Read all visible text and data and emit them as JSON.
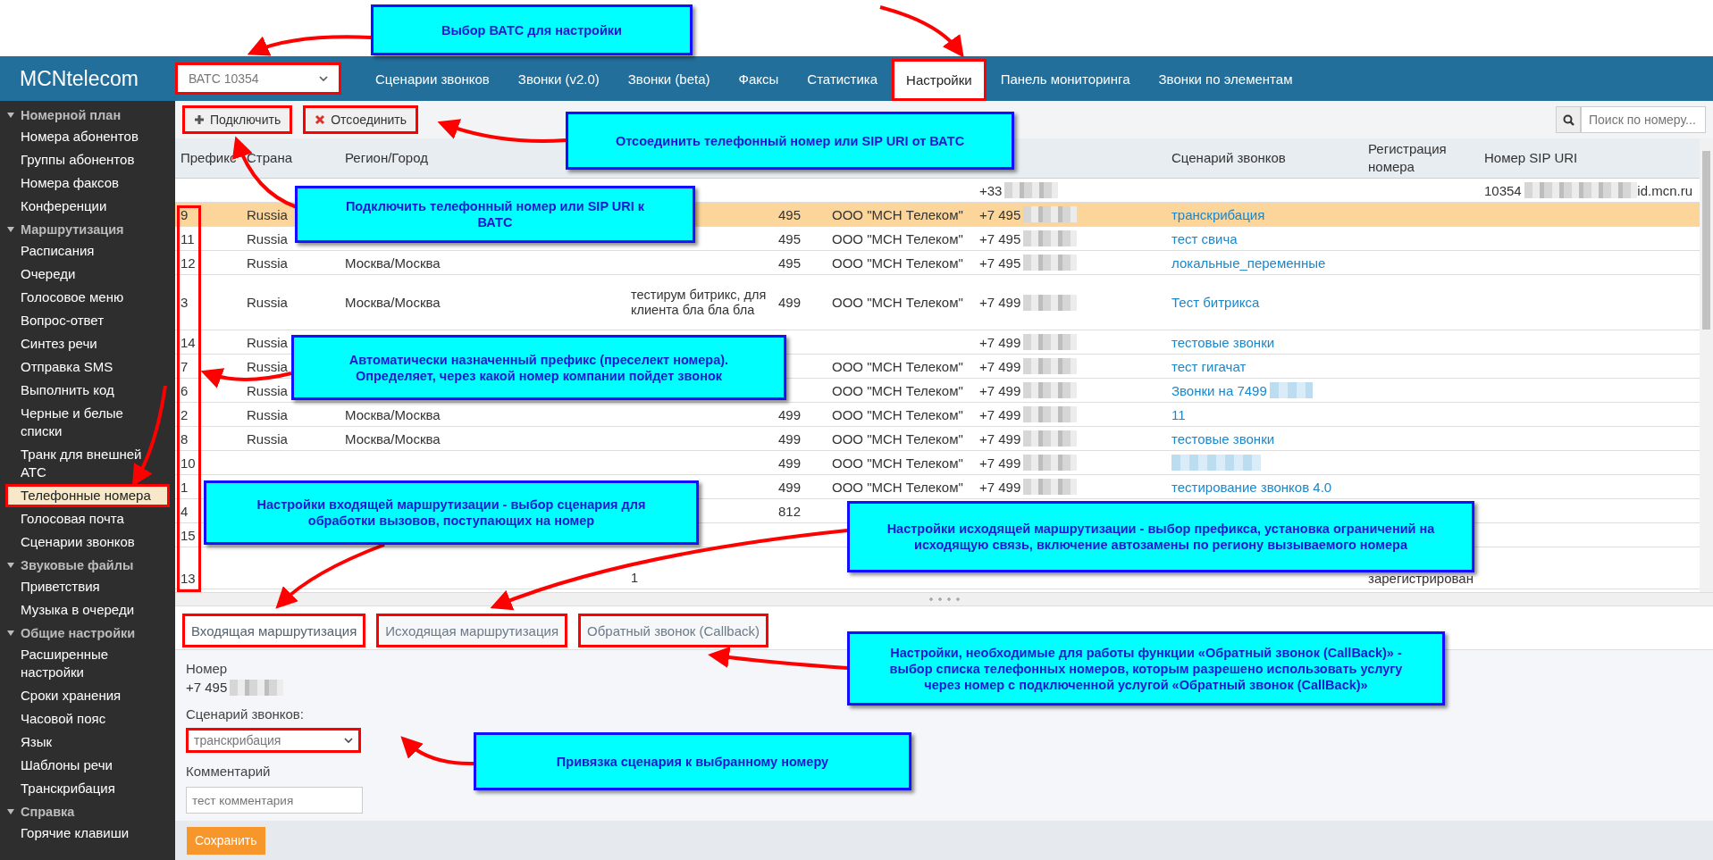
{
  "header": {
    "logo": "MCNtelecom",
    "pbx_select": {
      "value": "ВАТС 10354",
      "highlighted": true
    },
    "tabs": [
      {
        "label": "Сценарии звонков",
        "selected": false
      },
      {
        "label": "Звонки (v2.0)",
        "selected": false
      },
      {
        "label": "Звонки (beta)",
        "selected": false
      },
      {
        "label": "Факсы",
        "selected": false
      },
      {
        "label": "Статистика",
        "selected": false
      },
      {
        "label": "Настройки",
        "selected": true
      },
      {
        "label": "Панель мониторинга",
        "selected": false
      },
      {
        "label": "Звонки по элементам",
        "selected": false
      }
    ]
  },
  "sidebar": {
    "groups": [
      {
        "title": "Номерной план",
        "expanded": true,
        "items": [
          {
            "label": "Номера абонентов",
            "selected": false
          },
          {
            "label": "Группы абонентов",
            "selected": false
          },
          {
            "label": "Номера факсов",
            "selected": false
          },
          {
            "label": "Конференции",
            "selected": false
          }
        ]
      },
      {
        "title": "Маршрутизация",
        "expanded": true,
        "items": [
          {
            "label": "Расписания",
            "selected": false
          },
          {
            "label": "Очереди",
            "selected": false
          },
          {
            "label": "Голосовое меню",
            "selected": false
          },
          {
            "label": "Вопрос-ответ",
            "selected": false
          },
          {
            "label": "Синтез речи",
            "selected": false
          },
          {
            "label": "Отправка SMS",
            "selected": false
          },
          {
            "label": "Выполнить код",
            "selected": false
          },
          {
            "label": "Черные и белые списки",
            "selected": false
          },
          {
            "label": "Транк для внешней АТС",
            "selected": false
          },
          {
            "label": "Телефонные номера",
            "selected": true
          },
          {
            "label": "Голосовая почта",
            "selected": false
          },
          {
            "label": "Сценарии звонков",
            "selected": false
          }
        ]
      },
      {
        "title": "Звуковые файлы",
        "expanded": true,
        "items": [
          {
            "label": "Приветствия",
            "selected": false
          },
          {
            "label": "Музыка в очереди",
            "selected": false
          }
        ]
      },
      {
        "title": "Общие настройки",
        "expanded": true,
        "items": [
          {
            "label": "Расширенные настройки",
            "selected": false
          },
          {
            "label": "Сроки хранения",
            "selected": false
          },
          {
            "label": "Часовой пояс",
            "selected": false
          },
          {
            "label": "Язык",
            "selected": false
          },
          {
            "label": "Шаблоны речи",
            "selected": false
          },
          {
            "label": "Транскрибация",
            "selected": false
          }
        ]
      },
      {
        "title": "Справка",
        "expanded": true,
        "items": [
          {
            "label": "Горячие клавиши",
            "selected": false
          }
        ]
      }
    ]
  },
  "toolbar": {
    "buttons": [
      {
        "kind": "add",
        "label": "Подключить",
        "highlighted": true
      },
      {
        "kind": "remove",
        "label": "Отсоединить",
        "highlighted": true
      }
    ],
    "search": {
      "placeholder": "Поиск по номеру..."
    }
  },
  "table": {
    "prefix_column_highlighted": true,
    "columns": [
      {
        "label": "Префикс"
      },
      {
        "label": "Страна"
      },
      {
        "label": "Регион/Город"
      },
      {},
      {},
      {},
      {},
      {
        "label": "Сценарий звонков"
      },
      {
        "label": "Регистрация номера"
      },
      {
        "label": "Номер SIP URI"
      }
    ],
    "rows": [
      {
        "selected": false,
        "number": "+33",
        "sip_start": "10354",
        "sip_end": "id.mcn.ru"
      },
      {
        "selected": true,
        "prefix": "9",
        "country": "Russia",
        "code": "495",
        "operator": "ООО \"МСН Телеком\"",
        "number": "+7 495",
        "scenario": "транскрибация"
      },
      {
        "selected": false,
        "prefix": "11",
        "country": "Russia",
        "code": "495",
        "operator": "ООО \"МСН Телеком\"",
        "number": "+7 495",
        "scenario": "тест свича"
      },
      {
        "selected": false,
        "prefix": "12",
        "country": "Russia",
        "region": "Москва/Москва",
        "code": "495",
        "operator": "ООО \"МСН Телеком\"",
        "number": "+7 495",
        "scenario": "локальные_переменные"
      },
      {
        "selected": false,
        "prefix": "3",
        "country": "Russia",
        "region": "Москва/Москва",
        "comment": "тестирум битрикс, для клиента бла бла бла",
        "code": "499",
        "operator": "ООО \"МСН Телеком\"",
        "number": "+7 499",
        "scenario": "Тест битрикса"
      },
      {
        "selected": false,
        "prefix": "14",
        "country": "Russia",
        "number": "+7 499",
        "scenario": "тестовые звонки"
      },
      {
        "selected": false,
        "prefix": "7",
        "country": "Russia",
        "operator": "ООО \"МСН Телеком\"",
        "number": "+7 499",
        "scenario": "тест гигачат"
      },
      {
        "selected": false,
        "prefix": "6",
        "country": "Russia",
        "operator": "ООО \"МСН Телеком\"",
        "number": "+7 499",
        "scenario": "Звонки на 7499",
        "scenario_redacted": true
      },
      {
        "selected": false,
        "prefix": "2",
        "country": "Russia",
        "region": "Москва/Москва",
        "code": "499",
        "operator": "ООО \"МСН Телеком\"",
        "number": "+7 499",
        "scenario": "11"
      },
      {
        "selected": false,
        "prefix": "8",
        "country": "Russia",
        "region": "Москва/Москва",
        "code": "499",
        "operator": "ООО \"МСН Телеком\"",
        "number": "+7 499",
        "scenario": "тестовые звонки"
      },
      {
        "selected": false,
        "prefix": "10",
        "code": "499",
        "operator": "ООО \"МСН Телеком\"",
        "number": "+7 499",
        "scenario_redacted": true
      },
      {
        "selected": false,
        "prefix": "1",
        "code": "499",
        "operator": "ООО \"МСН Телеком\"",
        "number": "+7 499",
        "scenario": "тестирование звонков 4.0"
      },
      {
        "selected": false,
        "prefix": "4",
        "code": "812"
      },
      {
        "selected": false,
        "prefix": "15"
      },
      {
        "selected": false,
        "prefix": "13",
        "comment": "1",
        "registration": "зарегистрирован"
      }
    ]
  },
  "detail_tabs": [
    {
      "label": "Входящая маршрутизация",
      "selected": true,
      "highlighted": true
    },
    {
      "label": "Исходящая маршрутизация",
      "selected": false,
      "highlighted": true
    },
    {
      "label": "Обратный звонок (Callback)",
      "selected": false,
      "highlighted": true
    }
  ],
  "form": {
    "number_label": "Номер",
    "number_value": "+7 495",
    "scenario_label": "Сценарий звонков:",
    "scenario_select": {
      "value": "транскрибация",
      "highlighted": true
    },
    "comment_label": "Комментарий",
    "comment_field": {
      "placeholder": "тест комментария"
    },
    "save_button": "Сохранить"
  },
  "callouts": [
    {
      "text": "Выбор ВАТС для настройки"
    },
    {
      "text": "Отсоединить телефонный номер или SIP URI от ВАТС"
    },
    {
      "text": "Подключить телефонный номер или SIP URI к ВАТС"
    },
    {
      "text": "Автоматически назначенный префикс (преселект номера). Определяет, через какой номер компании пойдет звонок"
    },
    {
      "text": "Настройки входящей маршрутизации - выбор сценария для обработки вызовов, поступающих на номер"
    },
    {
      "text": "Настройки исходящей маршрутизации - выбор префикса, установка ограничений на исходящую связь, включение автозамены по региону вызываемого номера"
    },
    {
      "text": "Настройки, необходимые для работы функции «Обратный звонок (CallBack)» - выбор списка телефонных номеров, которым разрешено использовать услугу через  номер с подключенной услугой «Обратный звонок (CallBack)»"
    },
    {
      "text": "Привязка сценария к выбранному номеру"
    }
  ]
}
